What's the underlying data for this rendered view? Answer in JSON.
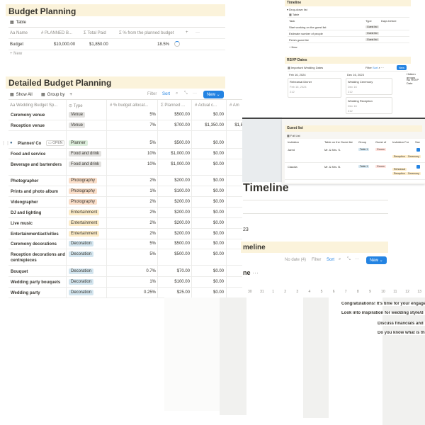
{
  "budget": {
    "title": "Budget Planning",
    "view": "Table",
    "columns": [
      "Name",
      "PLANNED B...",
      "Total Paid",
      "% from the planned budget"
    ],
    "row": {
      "name": "Budget",
      "planned": "$10,000.00",
      "paid": "$1,850.00",
      "percent": "18.5%"
    },
    "new_label": "New"
  },
  "detailed": {
    "title": "Detailed Budget Planning",
    "tabs": {
      "show_all": "Show All",
      "group_by": "Group by"
    },
    "toolbar": {
      "filter": "Filter",
      "sort": "Sort",
      "new": "New"
    },
    "columns": [
      "Wedding Budget Sp...",
      "Type",
      "% budget allocat...",
      "Planned ...",
      "Actual c...",
      "Am"
    ],
    "rows": [
      {
        "name": "Ceremony venue",
        "type": "Venue",
        "tagcls": "t-venue",
        "pct": "5%",
        "planned": "$500.00",
        "actual": "$0.00",
        "extra": ""
      },
      {
        "name": "Reception venue",
        "type": "Venue",
        "tagcls": "t-venue",
        "pct": "7%",
        "planned": "$700.00",
        "actual": "$1,350.00",
        "extra": "$1,8"
      },
      {
        "name": "Planner/ Co",
        "type": "Planner",
        "tagcls": "t-planner",
        "pct": "5%",
        "planned": "$500.00",
        "actual": "$0.00",
        "extra": ""
      },
      {
        "name": "Food and service",
        "type": "Food and drink",
        "tagcls": "t-food",
        "pct": "10%",
        "planned": "$1,000.00",
        "actual": "$0.00",
        "extra": ""
      },
      {
        "name": "Beverage and bartenders",
        "type": "Food and drink",
        "tagcls": "t-food",
        "pct": "10%",
        "planned": "$1,000.00",
        "actual": "$0.00",
        "extra": ""
      },
      {
        "name": "Photographer",
        "type": "Photography",
        "tagcls": "t-photo",
        "pct": "2%",
        "planned": "$200.00",
        "actual": "$0.00",
        "extra": ""
      },
      {
        "name": "Prints and photo album",
        "type": "Photography",
        "tagcls": "t-photo",
        "pct": "1%",
        "planned": "$100.00",
        "actual": "$0.00",
        "extra": ""
      },
      {
        "name": "Videographer",
        "type": "Photography",
        "tagcls": "t-photo",
        "pct": "2%",
        "planned": "$200.00",
        "actual": "$0.00",
        "extra": ""
      },
      {
        "name": "DJ and lighting",
        "type": "Entertainment",
        "tagcls": "t-ent",
        "pct": "2%",
        "planned": "$200.00",
        "actual": "$0.00",
        "extra": ""
      },
      {
        "name": "Live music",
        "type": "Entertainment",
        "tagcls": "t-ent",
        "pct": "2%",
        "planned": "$200.00",
        "actual": "$0.00",
        "extra": ""
      },
      {
        "name": "Entertainment/activities",
        "type": "Entertainment",
        "tagcls": "t-ent",
        "pct": "2%",
        "planned": "$200.00",
        "actual": "$0.00",
        "extra": ""
      },
      {
        "name": "Ceremony decorations",
        "type": "Decoration",
        "tagcls": "t-deco",
        "pct": "5%",
        "planned": "$500.00",
        "actual": "$0.00",
        "extra": ""
      },
      {
        "name": "Reception decorations and centrepieces",
        "type": "Decoration",
        "tagcls": "t-deco",
        "pct": "5%",
        "planned": "$500.00",
        "actual": "$0.00",
        "extra": ""
      },
      {
        "name": "Bouquet",
        "type": "Decoration",
        "tagcls": "t-deco",
        "pct": "0.7%",
        "planned": "$70.00",
        "actual": "$0.00",
        "extra": ""
      },
      {
        "name": "Wedding party bouquets",
        "type": "Decoration",
        "tagcls": "t-deco",
        "pct": "1%",
        "planned": "$100.00",
        "actual": "$0.00",
        "extra": ""
      },
      {
        "name": "Wedding party",
        "type": "Decoration",
        "tagcls": "t-deco",
        "pct": "0.25%",
        "planned": "$25.00",
        "actual": "$0.00",
        "extra": ""
      }
    ],
    "open_label": "OPEN"
  },
  "timeline_small": {
    "title": "Timeline",
    "subview": "Drop-down list",
    "view": "Table",
    "columns": [
      "Task",
      "Type",
      "Days before"
    ],
    "rows": [
      {
        "task": "Start working on the guest list",
        "type": "Guest list"
      },
      {
        "task": "Estimate number of people",
        "type": "Guest list"
      },
      {
        "task": "Finish guest list",
        "type": "Guest list"
      }
    ],
    "new_label": "New"
  },
  "rsvp": {
    "title": "RSVP Dates",
    "view": "Important Wedding Dates",
    "new": "New",
    "col1": "Feb 16, 2024",
    "col2": "Dec 16, 2023",
    "cards": [
      {
        "title": "Rehearsal Dinner",
        "date": "Feb 16, 2024",
        "extra": "212"
      },
      {
        "title": "Wedding Ceremony",
        "date": "Dec 16",
        "extra": "212"
      },
      {
        "title": "Wedding Reception",
        "date": "Dec 16",
        "extra": "212"
      }
    ],
    "side": "Hidden groups",
    "side2": "No RSVP Date"
  },
  "guest": {
    "title": "Guest list",
    "view": "Full List",
    "columns": [
      "Invitation",
      "Table on the Guest list",
      "Group",
      "Guest of",
      "Invitation For",
      "Sav"
    ],
    "rows": [
      {
        "name": "Jared",
        "table": "Mr. & Mrs. S.",
        "group": "Table 1",
        "of": "Groom",
        "tags": [
          "Reception",
          "Ceremony",
          "Rehearsal"
        ]
      },
      {
        "name": "Claudia",
        "table": "Mr. & Mrs. B.",
        "group": "Table 1",
        "of": "Groom",
        "tags": [
          "Reception",
          "Ceremony",
          "Rehearsal"
        ]
      }
    ]
  },
  "timeline_big": {
    "title": "Timeline",
    "partial": "23",
    "sub": "meline",
    "nodate": "No date (4)",
    "filter": "Filter",
    "sort": "Sort",
    "new": "New",
    "label": "ne",
    "days": [
      "30",
      "31",
      "1",
      "2",
      "3",
      "4",
      "5",
      "6",
      "7",
      "8",
      "9",
      "10",
      "11",
      "12",
      "13"
    ],
    "items": [
      "Congratulations! It's time for your engage",
      "Look into inspiration for wedding style/d",
      "Discuss financials and",
      "Do you know what is th"
    ]
  }
}
